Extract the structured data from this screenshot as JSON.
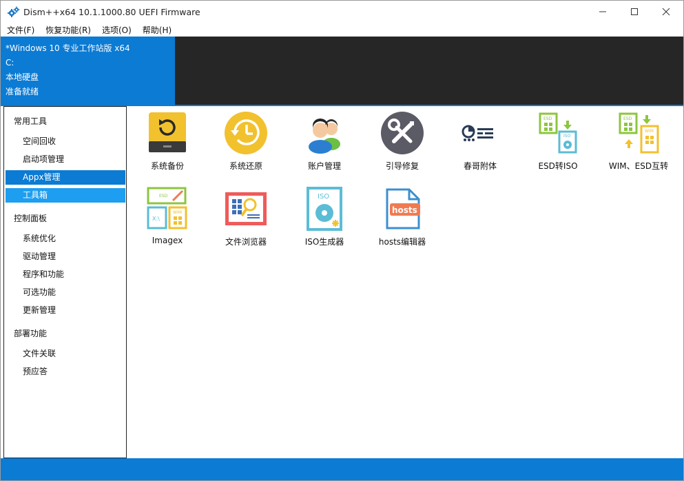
{
  "window": {
    "title": "Dism++x64 10.1.1000.80 UEFI Firmware"
  },
  "menu": [
    {
      "label": "文件(F)"
    },
    {
      "label": "恢复功能(R)"
    },
    {
      "label": "选项(O)"
    },
    {
      "label": "帮助(H)"
    }
  ],
  "system_info": {
    "name": "*Windows 10 专业工作站版 x64",
    "drive": "C:",
    "disk_type": "本地硬盘",
    "status": "准备就绪"
  },
  "sidebar": {
    "groups": [
      {
        "label": "常用工具",
        "items": [
          {
            "label": "空间回收"
          },
          {
            "label": "启动项管理"
          },
          {
            "label": "Appx管理"
          },
          {
            "label": "工具箱"
          }
        ]
      },
      {
        "label": "控制面板",
        "items": [
          {
            "label": "系统优化"
          },
          {
            "label": "驱动管理"
          },
          {
            "label": "程序和功能"
          },
          {
            "label": "可选功能"
          },
          {
            "label": "更新管理"
          }
        ]
      },
      {
        "label": "部署功能",
        "items": [
          {
            "label": "文件关联"
          },
          {
            "label": "预应答"
          }
        ]
      }
    ]
  },
  "tools": [
    {
      "label": "系统备份",
      "icon": "backup-icon"
    },
    {
      "label": "系统还原",
      "icon": "restore-icon"
    },
    {
      "label": "账户管理",
      "icon": "accounts-icon"
    },
    {
      "label": "引导修复",
      "icon": "boot-repair-icon"
    },
    {
      "label": "春哥附体",
      "icon": "chunge-icon"
    },
    {
      "label": "ESD转ISO",
      "icon": "esd-to-iso-icon"
    },
    {
      "label": "WIM、ESD互转",
      "icon": "wim-esd-convert-icon"
    },
    {
      "label": "Imagex",
      "icon": "imagex-icon"
    },
    {
      "label": "文件浏览器",
      "icon": "file-browser-icon"
    },
    {
      "label": "ISO生成器",
      "icon": "iso-maker-icon"
    },
    {
      "label": "hosts编辑器",
      "icon": "hosts-editor-icon"
    }
  ],
  "colors": {
    "accent": "#0b7bd4",
    "selection_light": "#1e9ef0",
    "console_bg": "#262626"
  }
}
